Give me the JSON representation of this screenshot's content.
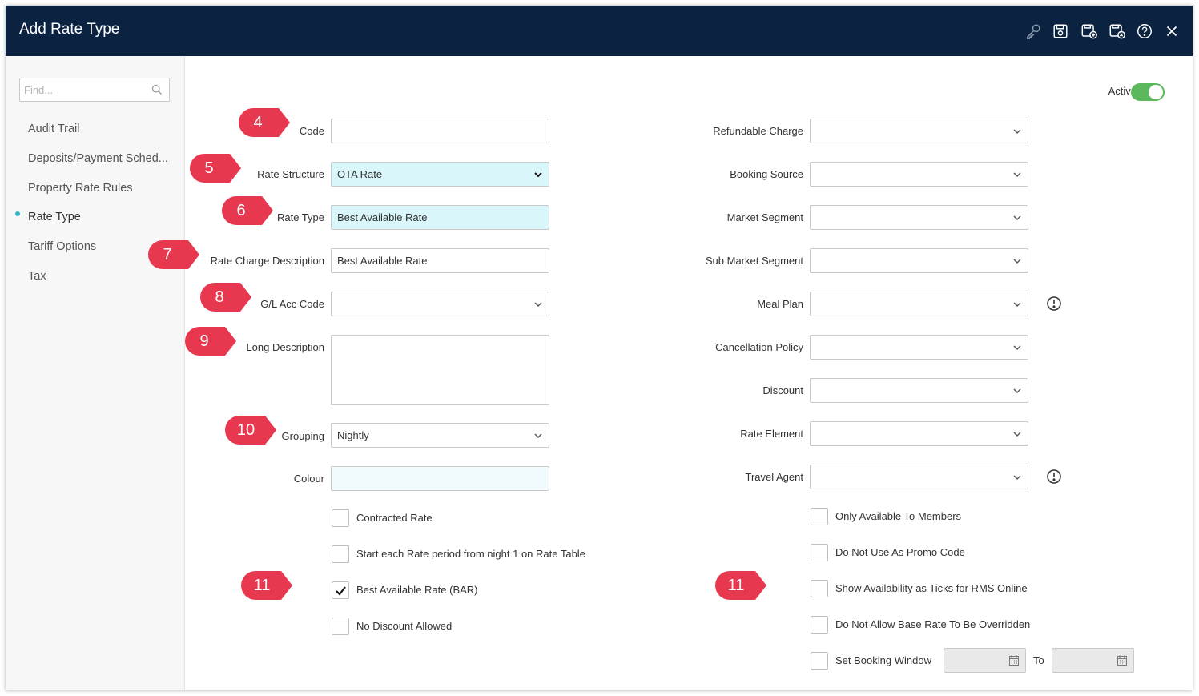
{
  "window": {
    "title": "Add Rate Type"
  },
  "toolbar": {
    "icons": [
      "key-icon",
      "save-icon",
      "save-new-icon",
      "save-close-icon",
      "help-icon",
      "close-icon"
    ]
  },
  "sidebar": {
    "search_placeholder": "Find...",
    "items": [
      {
        "label": "Audit Trail"
      },
      {
        "label": "Deposits/Payment Sched..."
      },
      {
        "label": "Property Rate Rules"
      },
      {
        "label": "Rate Type",
        "active": true
      },
      {
        "label": "Tariff Options"
      },
      {
        "label": "Tax"
      }
    ],
    "active_dot_color": "#2fb4c6"
  },
  "header": {
    "active_label": "Active",
    "active_on": true,
    "toggle_color": "#5cb85c"
  },
  "form_left": {
    "code": {
      "label": "Code",
      "value": ""
    },
    "rate_structure": {
      "label": "Rate Structure",
      "value": "OTA Rate"
    },
    "rate_type": {
      "label": "Rate Type",
      "value": "Best Available Rate"
    },
    "rate_charge_description": {
      "label": "Rate Charge Description",
      "value": "Best Available Rate"
    },
    "gl_acc_code": {
      "label": "G/L Acc Code",
      "value": ""
    },
    "long_description": {
      "label": "Long Description",
      "value": ""
    },
    "grouping": {
      "label": "Grouping",
      "value": "Nightly"
    },
    "colour": {
      "label": "Colour",
      "value": ""
    }
  },
  "form_right": {
    "refundable_charge": {
      "label": "Refundable Charge",
      "value": ""
    },
    "booking_source": {
      "label": "Booking Source",
      "value": ""
    },
    "market_segment": {
      "label": "Market Segment",
      "value": ""
    },
    "sub_market_segment": {
      "label": "Sub Market Segment",
      "value": ""
    },
    "meal_plan": {
      "label": "Meal Plan",
      "value": ""
    },
    "cancellation_policy": {
      "label": "Cancellation Policy",
      "value": ""
    },
    "discount": {
      "label": "Discount",
      "value": ""
    },
    "rate_element": {
      "label": "Rate Element",
      "value": ""
    },
    "travel_agent": {
      "label": "Travel Agent",
      "value": ""
    }
  },
  "checkboxes_left": [
    {
      "label": "Contracted Rate",
      "checked": false
    },
    {
      "label": "Start each Rate period from night 1 on Rate Table",
      "checked": false
    },
    {
      "label": "Best Available Rate (BAR)",
      "checked": true
    },
    {
      "label": "No Discount Allowed",
      "checked": false
    }
  ],
  "checkboxes_right": [
    {
      "label": "Only Available To Members",
      "checked": false
    },
    {
      "label": "Do Not Use As Promo Code",
      "checked": false
    },
    {
      "label": "Show Availability as Ticks for RMS Online",
      "checked": false
    },
    {
      "label": "Do Not Allow Base Rate To Be Overridden",
      "checked": false
    },
    {
      "label": "Set Booking Window",
      "checked": false
    }
  ],
  "booking_window": {
    "to_label": "To",
    "from_value": "",
    "to_value": ""
  },
  "markers": {
    "color": "#e8384f",
    "labels": [
      "4",
      "5",
      "6",
      "7",
      "8",
      "9",
      "10",
      "11",
      "11"
    ]
  }
}
